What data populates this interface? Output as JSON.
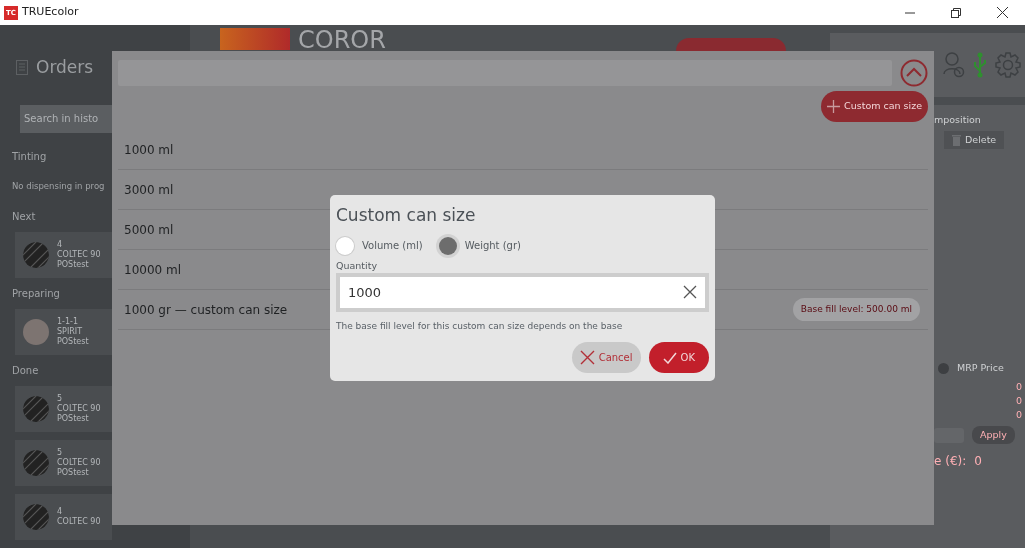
{
  "window": {
    "logo": "TC",
    "title": "TRUEcolor"
  },
  "sidebar": {
    "title": "Orders",
    "search_placeholder": "Search in histo",
    "sections": [
      {
        "label": "Tinting",
        "empty_text": "No dispensing in prog"
      },
      {
        "label": "Next",
        "orders": [
          {
            "number": "4",
            "product": "COLTEC 90",
            "customer": "POStest",
            "kind": "striped"
          }
        ]
      },
      {
        "label": "Preparing",
        "orders": [
          {
            "number": "1-1-1",
            "product": "SPIRIT",
            "customer": "POStest",
            "kind": "solid",
            "color": "#7d7471"
          }
        ]
      },
      {
        "label": "Done",
        "orders": [
          {
            "number": "5",
            "product": "COLTEC 90",
            "customer": "POStest",
            "kind": "striped"
          },
          {
            "number": "5",
            "product": "COLTEC 90",
            "customer": "POStest",
            "kind": "striped"
          },
          {
            "number": "4",
            "product": "COLTEC 90",
            "kind": "striped"
          }
        ]
      }
    ]
  },
  "header": {
    "brand": "COROR"
  },
  "right_panel": {
    "section_label": "mposition",
    "delete_button": "Delete",
    "price_option": {
      "label": "MRP Price",
      "selected": true
    },
    "values": [
      "0",
      "0",
      "0"
    ],
    "apply_button": "Apply",
    "total_label": "e (€):",
    "total_value": "0"
  },
  "can_sizes": {
    "add_button": "Custom can size",
    "items": [
      {
        "label": "1000 ml"
      },
      {
        "label": "3000 ml"
      },
      {
        "label": "5000 ml"
      },
      {
        "label": "10000 ml"
      },
      {
        "label": "1000 gr — custom can size",
        "badge": "Base fill level: 500.00 ml"
      }
    ]
  },
  "dialog": {
    "title": "Custom can size",
    "units": [
      {
        "label": "Volume (ml)",
        "selected": false
      },
      {
        "label": "Weight (gr)",
        "selected": true
      }
    ],
    "quantity_label": "Quantity",
    "quantity_value": "1000",
    "hint": "The base fill level for this custom can size depends on the base",
    "buttons": [
      {
        "kind": "cancel",
        "label": "Cancel"
      },
      {
        "kind": "ok",
        "label": "OK"
      }
    ]
  }
}
